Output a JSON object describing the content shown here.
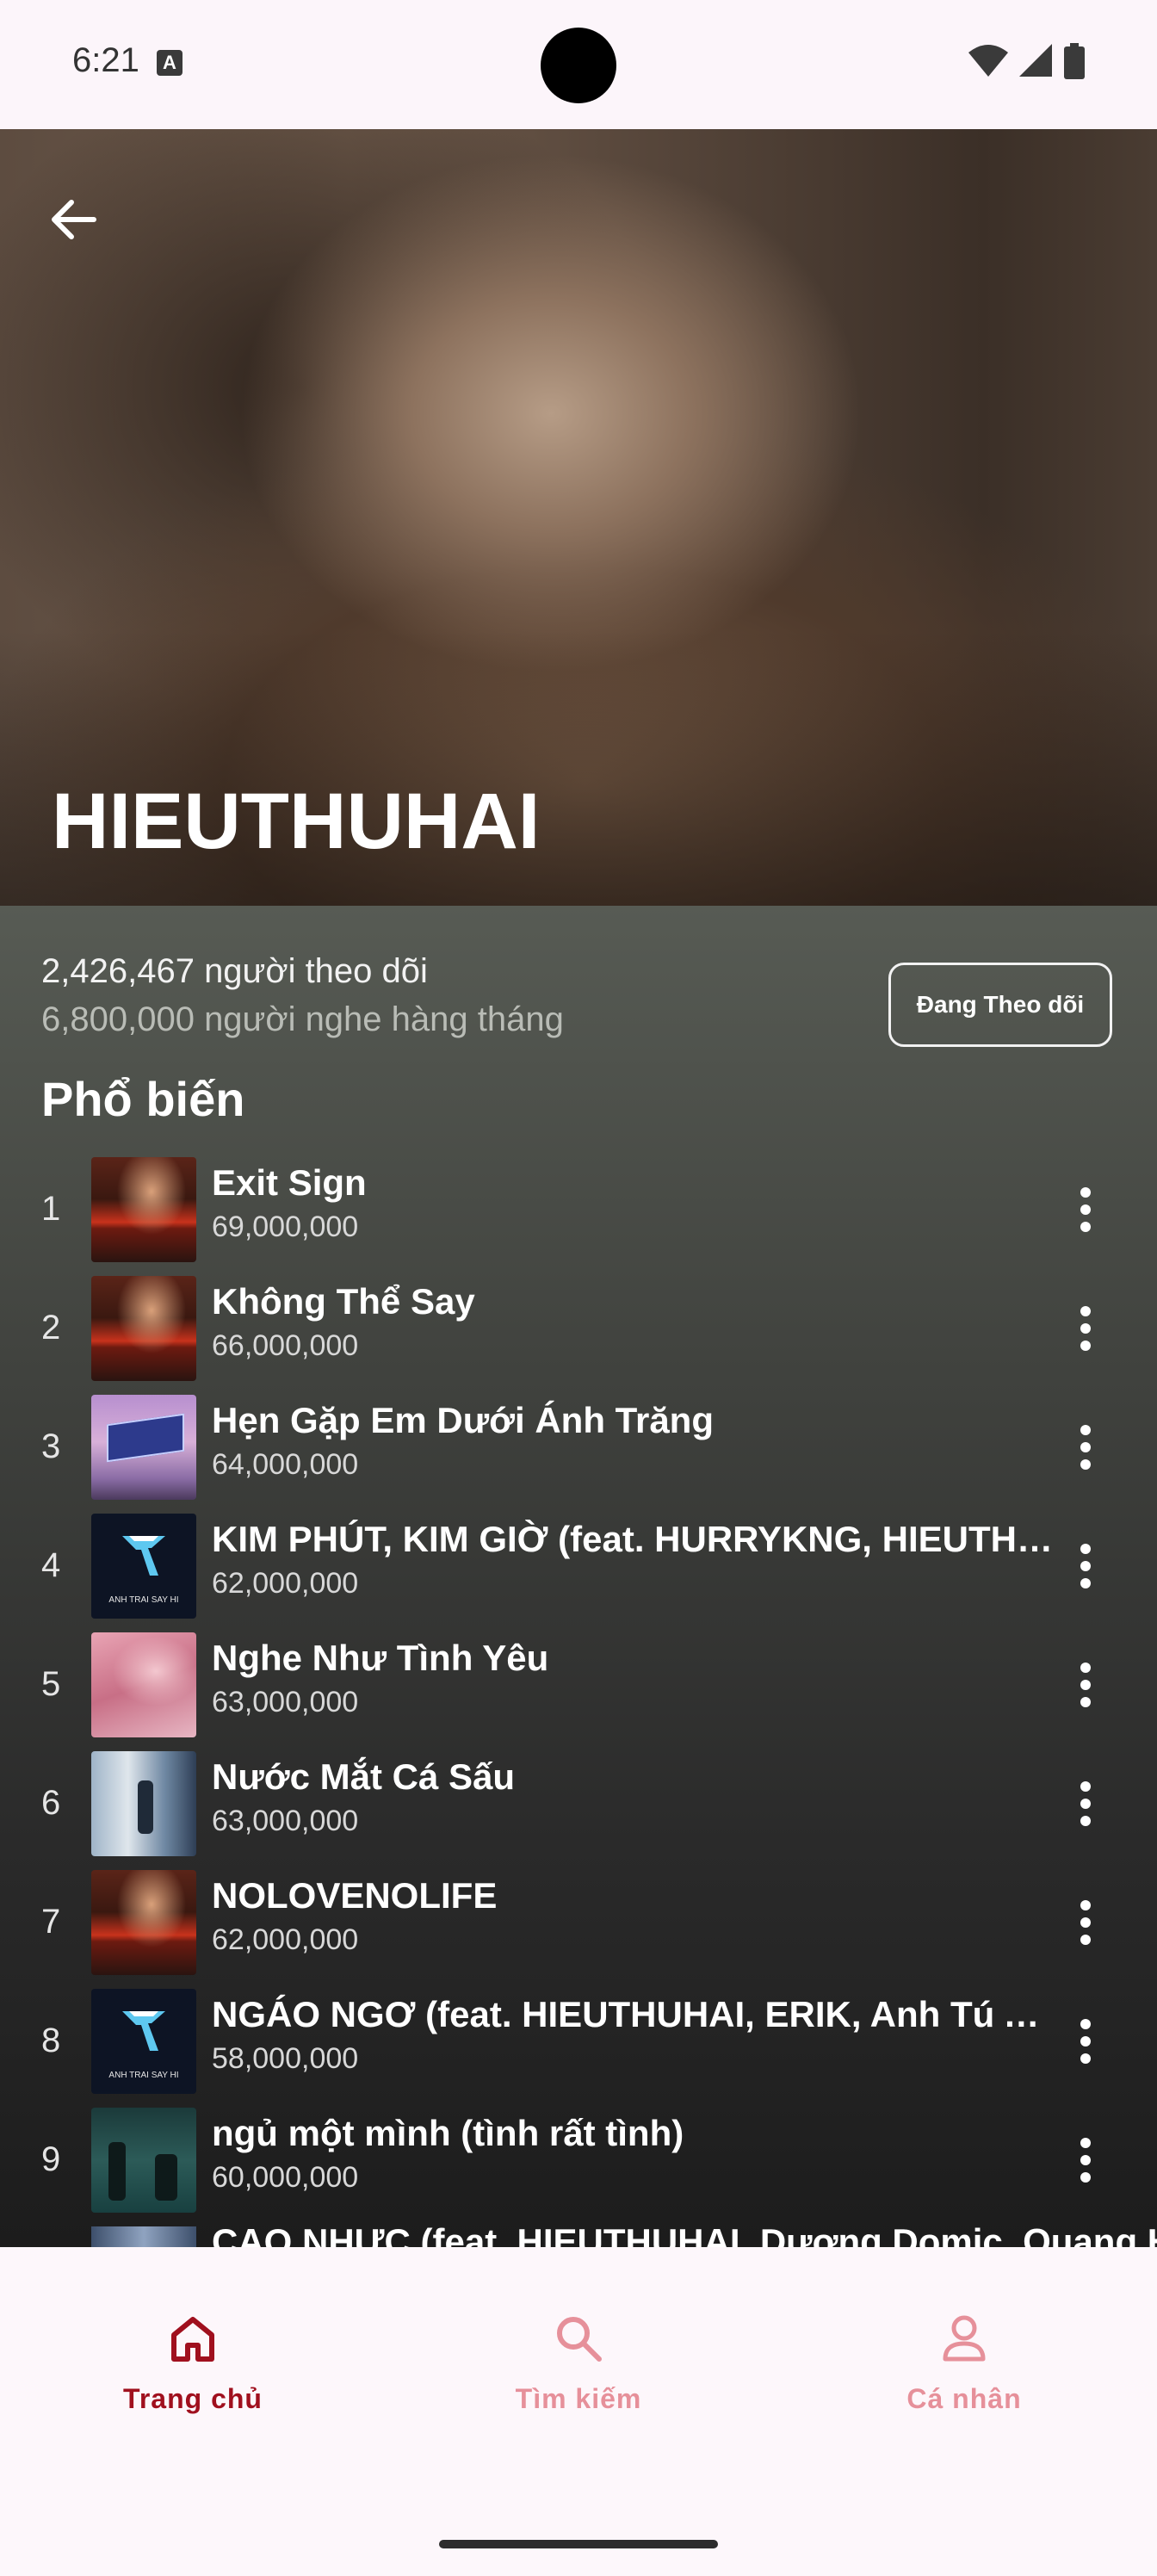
{
  "status_bar": {
    "time": "6:21",
    "notification_icon": "keyboard-a-icon",
    "icons": [
      "wifi-icon",
      "signal-icon",
      "battery-icon"
    ]
  },
  "hero": {
    "back_icon": "arrow-left-icon",
    "artist_name": "HIEUTHUHAI"
  },
  "stats": {
    "followers": "2,426,467 người theo dõi",
    "monthly_listeners": "6,800,000 người nghe hàng tháng",
    "follow_button": "Đang Theo dõi"
  },
  "popular": {
    "title": "Phổ biến",
    "tracks": [
      {
        "rank": "1",
        "title": "Exit Sign",
        "plays": "69,000,000",
        "art": "exit"
      },
      {
        "rank": "2",
        "title": "Không Thể Say",
        "plays": "66,000,000",
        "art": "exit"
      },
      {
        "rank": "3",
        "title": "Hẹn Gặp Em Dưới Ánh Trăng",
        "plays": "64,000,000",
        "art": "billboard"
      },
      {
        "rank": "4",
        "title": "KIM PHÚT, KIM GIỜ (feat. HURRYKNG, HIEUTHUHAI, Negav, Isaac, Phạm Anh Duy)",
        "plays": "62,000,000",
        "art": "atsh"
      },
      {
        "rank": "5",
        "title": "Nghe Như Tình Yêu",
        "plays": "63,000,000",
        "art": "pink"
      },
      {
        "rank": "6",
        "title": "Nước Mắt Cá Sấu",
        "plays": "63,000,000",
        "art": "croc"
      },
      {
        "rank": "7",
        "title": "NOLOVENOLIFE",
        "plays": "62,000,000",
        "art": "exit"
      },
      {
        "rank": "8",
        "title": "NGÁO NGƠ (feat. HIEUTHUHAI, ERIK, Anh Tú Atus, JSOL, Orange)",
        "plays": "58,000,000",
        "art": "atsh"
      },
      {
        "rank": "9",
        "title": "ngủ một mình (tình rất tình)",
        "plays": "60,000,000",
        "art": "nguoi"
      }
    ],
    "peek_title": "CAO NHƯC (feat. HIEUTHUHAI, Dương Domic, Quang Hùng MasterD)"
  },
  "bottom_nav": {
    "items": [
      {
        "label": "Trang chủ",
        "icon": "home-icon",
        "active": true
      },
      {
        "label": "Tìm kiếm",
        "icon": "search-icon",
        "active": false
      },
      {
        "label": "Cá nhân",
        "icon": "person-icon",
        "active": false
      }
    ],
    "active_color": "#a0101e",
    "inactive_color": "#e6909a"
  },
  "atsh_band_text": "ANH TRAI SAY HI"
}
